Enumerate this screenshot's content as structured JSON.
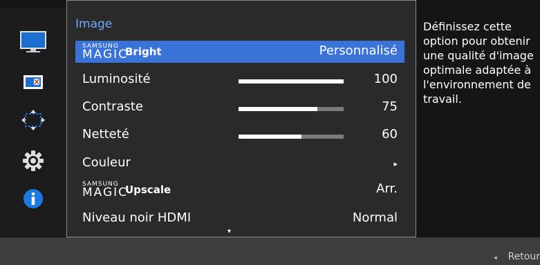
{
  "sidebar": {
    "icons": [
      "monitor-icon",
      "picture-size-icon",
      "position-icon",
      "gear-icon",
      "info-icon"
    ],
    "selected_index": 0
  },
  "menu": {
    "title": "Image",
    "items": [
      {
        "label_samsung": "SAMSUNG",
        "label_magic": "MAGIC",
        "label_product": "Bright",
        "value": "Personnalisé",
        "selected": true
      },
      {
        "label": "Luminosité",
        "value": "100",
        "level": 1.0
      },
      {
        "label": "Contraste",
        "value": "75",
        "level": 0.75
      },
      {
        "label": "Netteté",
        "value": "60",
        "level": 0.6
      },
      {
        "label": "Couleur",
        "value": "▸"
      },
      {
        "label_samsung": "SAMSUNG",
        "label_magic": "MAGIC",
        "label_product": "Upscale",
        "value": "Arr."
      },
      {
        "label": "Niveau noir HDMI",
        "value": "Normal"
      }
    ],
    "scroll_indicator": "▾"
  },
  "help_text": "Définissez cette option pour obtenir une qualité d'image optimale adaptée à l'environnement de travail.",
  "footer": {
    "back_arrow": "◂",
    "back_label": "Retour"
  },
  "colors": {
    "accent": "#3a73d8",
    "title": "#6fa9ff"
  }
}
